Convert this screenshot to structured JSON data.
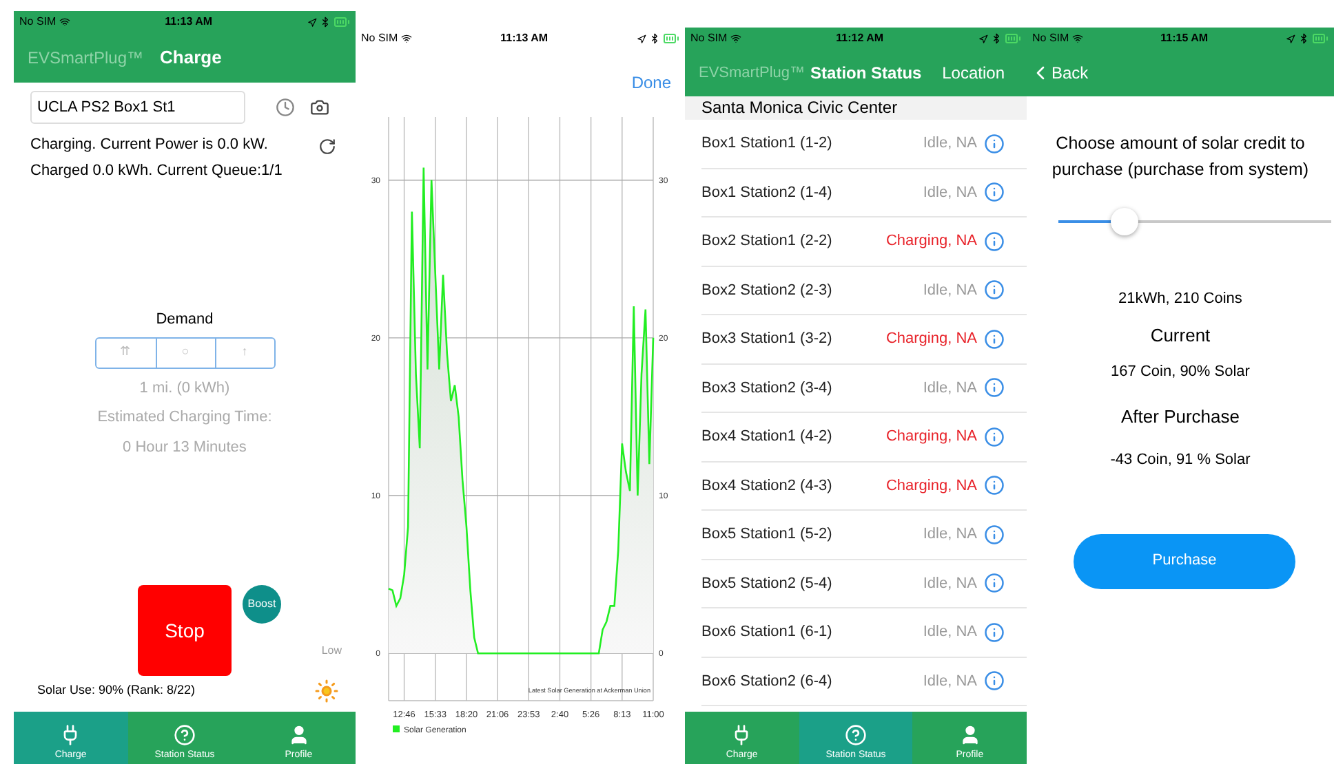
{
  "charge_screen": {
    "status_bar": {
      "carrier": "No SIM",
      "time": "11:13 AM"
    },
    "nav": {
      "app_title": "EVSmartPlug™",
      "title": "Charge"
    },
    "station_field": {
      "value": "UCLA PS2 Box1 St1"
    },
    "status_lines": [
      "Charging. Current Power is 0.0 kW.",
      "Charged 0.0 kWh. Current Queue:1/1"
    ],
    "demand": {
      "label": "Demand",
      "segments": [
        "⇈",
        "○",
        "↑"
      ],
      "distance": "1 mi. (0 kWh)",
      "time_label": "Estimated Charging Time:",
      "time_value": "0 Hour 13 Minutes"
    },
    "stop_button": "Stop",
    "boost_button": "Boost",
    "solar_level": "Low",
    "solar_use": "Solar Use: 90% (Rank: 8/22)",
    "tab_bar": [
      {
        "label": "Charge",
        "kind": "plug",
        "selected": true
      },
      {
        "label": "Station Status",
        "kind": "help",
        "selected": false
      },
      {
        "label": "Profile",
        "kind": "person",
        "selected": false
      }
    ]
  },
  "chart_screen": {
    "status_bar": {
      "carrier": "No SIM",
      "time": "11:13 AM"
    },
    "done_button": "Done",
    "chart_data": {
      "type": "area",
      "categories": [
        null,
        null,
        null,
        null,
        "12:46",
        null,
        null,
        null,
        null,
        null,
        null,
        null,
        "15:33",
        null,
        null,
        null,
        null,
        null,
        null,
        null,
        "18:20",
        null,
        null,
        null,
        null,
        null,
        null,
        null,
        "21:06",
        null,
        null,
        null,
        null,
        null,
        null,
        null,
        "23:53",
        null,
        null,
        null,
        null,
        null,
        null,
        null,
        "2:40",
        null,
        null,
        null,
        null,
        null,
        null,
        null,
        "5:26",
        null,
        null,
        null,
        null,
        null,
        null,
        null,
        "8:13",
        null,
        null,
        null,
        null,
        null,
        null,
        null,
        "11:00"
      ],
      "series": [
        {
          "name": "Solar Generation",
          "color": "#22ee22",
          "values": [
            4.1,
            4,
            3,
            3.5,
            5,
            8,
            28,
            17.7,
            13,
            30.8,
            18,
            30,
            24,
            18,
            24,
            19,
            16,
            17,
            15,
            11,
            8,
            4,
            1,
            0,
            0,
            0,
            0,
            0,
            0,
            0,
            0,
            0,
            0,
            0,
            0,
            0,
            0,
            0,
            0,
            0,
            0,
            0,
            0,
            0,
            0,
            0,
            0,
            0,
            0,
            0,
            0,
            0,
            0,
            0,
            0,
            1.5,
            2,
            3,
            3,
            6.5,
            13.3,
            11.5,
            10.3,
            22,
            10,
            17.7,
            21.8,
            12,
            20
          ]
        }
      ],
      "ylim": [
        -3,
        34
      ],
      "y2lim": [
        -3,
        34
      ],
      "grid": true,
      "yticks": [
        0,
        10,
        20,
        30
      ],
      "y2ticks": [
        0,
        10,
        20,
        30
      ],
      "annotations": [
        "Latest Solar Generation at Ackerman Union"
      ]
    }
  },
  "station_screen": {
    "status_bar": {
      "carrier": "No SIM",
      "time": "11:12 AM"
    },
    "nav": {
      "app_title": "EVSmartPlug™",
      "title": "Station Status",
      "action": "Location"
    },
    "section": "Santa Monica Civic Center",
    "stations": [
      {
        "name": "Box1 Station1 (1-2)",
        "status": "Idle, NA",
        "charging": false
      },
      {
        "name": "Box1 Station2 (1-4)",
        "status": "Idle, NA",
        "charging": false
      },
      {
        "name": "Box2 Station1 (2-2)",
        "status": "Charging, NA",
        "charging": true
      },
      {
        "name": "Box2 Station2 (2-3)",
        "status": "Idle, NA",
        "charging": false
      },
      {
        "name": "Box3 Station1 (3-2)",
        "status": "Charging, NA",
        "charging": true
      },
      {
        "name": "Box3 Station2 (3-4)",
        "status": "Idle, NA",
        "charging": false
      },
      {
        "name": "Box4 Station1 (4-2)",
        "status": "Charging, NA",
        "charging": true
      },
      {
        "name": "Box4 Station2 (4-3)",
        "status": "Charging, NA",
        "charging": true
      },
      {
        "name": "Box5 Station1 (5-2)",
        "status": "Idle, NA",
        "charging": false
      },
      {
        "name": "Box5 Station2 (5-4)",
        "status": "Idle, NA",
        "charging": false
      },
      {
        "name": "Box6 Station1 (6-1)",
        "status": "Idle, NA",
        "charging": false
      },
      {
        "name": "Box6 Station2 (6-4)",
        "status": "Idle, NA",
        "charging": false
      }
    ],
    "tab_bar": [
      {
        "label": "Charge",
        "kind": "plug",
        "selected": false
      },
      {
        "label": "Station Status",
        "kind": "help",
        "selected": true
      },
      {
        "label": "Profile",
        "kind": "person",
        "selected": false
      }
    ]
  },
  "purchase_screen": {
    "status_bar": {
      "carrier": "No SIM",
      "time": "11:15 AM"
    },
    "back_button": "Back",
    "prompt": "Choose amount of solar credit to purchase (purchase from system)",
    "slider": {
      "level": 0.24
    },
    "amount": "21kWh, 210 Coins",
    "current_label": "Current",
    "current_value": "167 Coin, 90% Solar",
    "after_label": "After Purchase",
    "after_value": "-43 Coin, 91 % Solar",
    "purchase_button": "Purchase"
  }
}
